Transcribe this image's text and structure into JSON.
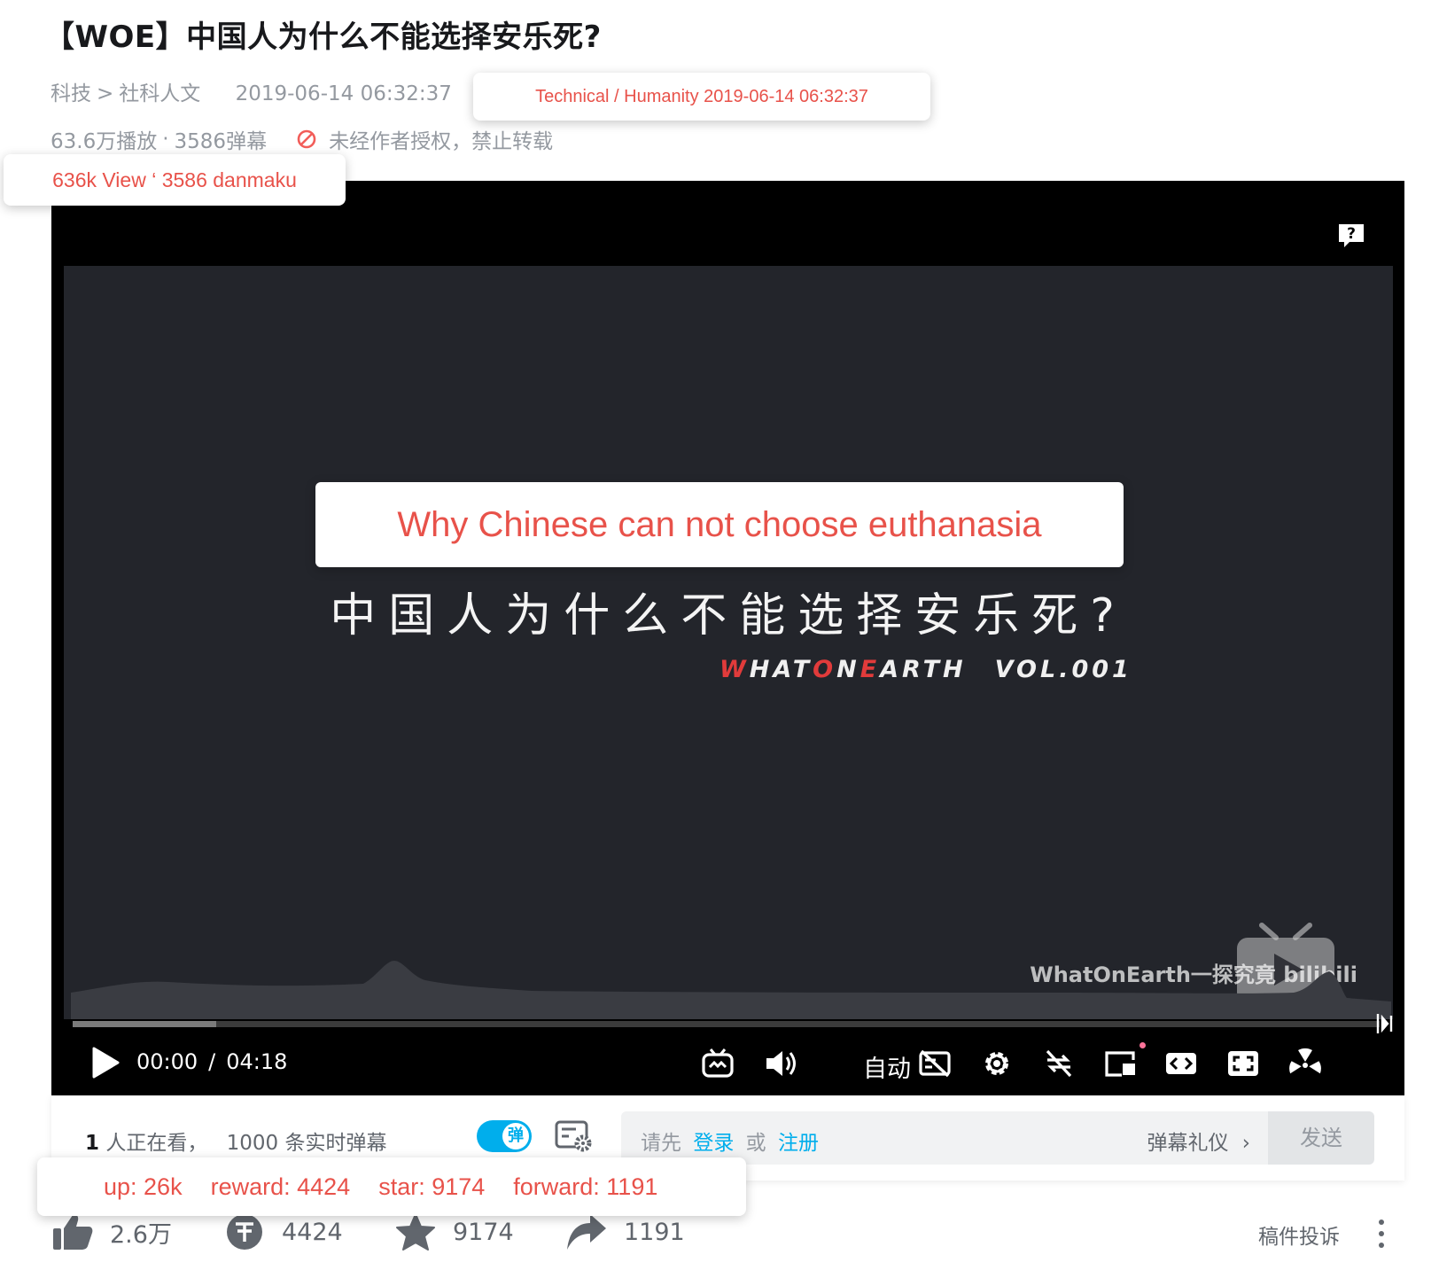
{
  "video": {
    "title": "【WOE】中国人为什么不能选择安乐死?",
    "category": "科技",
    "category_separator": ">",
    "subcategory": "社科人文",
    "pubdate": "2019-06-14 06:32:37",
    "views": "63.6万播放",
    "danmaku_count": "3586弹幕",
    "stat_separator": "·",
    "copyright_notice": "未经作者授权，禁止转载"
  },
  "annotations": {
    "meta": "Technical / Humanity  2019-06-14 06:32:37",
    "views": "636k View ‘ 3586 danmaku",
    "title": "Why Chinese can not choose euthanasia",
    "stats": {
      "up": "up: 26k",
      "reward": "reward: 4424",
      "star": "star: 9174",
      "forward": "forward: 1191"
    }
  },
  "frame": {
    "cn_title": "中国人为什么不能选择安乐死?",
    "brand": {
      "p1": "W",
      "p2": "HAT",
      "p3": "O",
      "p4": "N",
      "p5": "E",
      "p6": "ARTH"
    },
    "volume": "VOL.001",
    "watermark": "WhatOnEarth一探究竟 bilibili"
  },
  "player": {
    "current_time": "00:00",
    "time_separator": "/",
    "duration": "04:18",
    "played_fraction": 0.0,
    "buffered_fraction": 0.11,
    "quality_label": "自动"
  },
  "danmaku_bar": {
    "online_count": "1",
    "online_text": "人正在看，",
    "live_count": "1000",
    "live_text": "条实时弹幕",
    "toggle_label": "弹",
    "toggle_on": true,
    "input_prefix": "请先",
    "login_link": "登录",
    "or_text": "或",
    "register_link": "注册",
    "etiquette": "弹幕礼仪",
    "send": "发送"
  },
  "toolbar": {
    "like": "2.6万",
    "coin": "4424",
    "favorite": "9174",
    "share": "1191",
    "report": "稿件投诉"
  },
  "colors": {
    "accent": "#00aeec",
    "annotation": "#e8524a",
    "pink": "#fb7299"
  }
}
